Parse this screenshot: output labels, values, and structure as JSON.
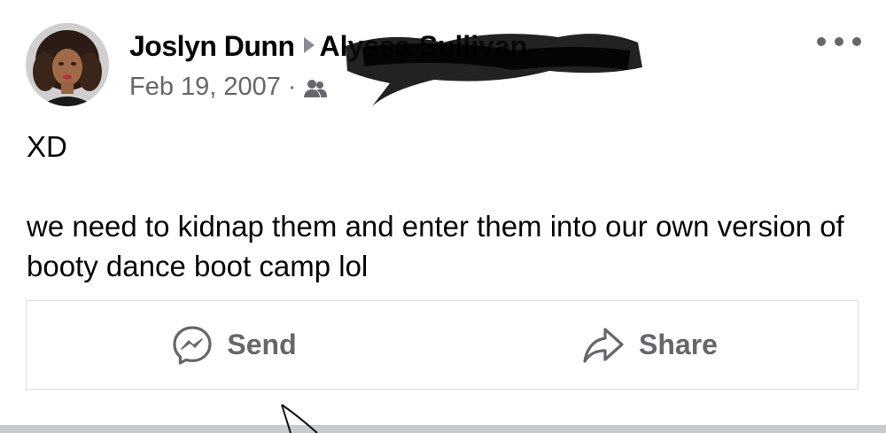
{
  "post": {
    "author": "Joslyn Dunn",
    "recipient": "Alyssa Sullivan",
    "date": "Feb 19, 2007",
    "separator": "·",
    "audience_icon": "friends-icon",
    "body_lines": [
      "XD",
      "we need to kidnap them and enter them into our own version of booty dance boot camp lol"
    ]
  },
  "actions": {
    "send_label": "Send",
    "send_icon": "messenger-icon",
    "share_label": "Share",
    "share_icon": "share-arrow-icon"
  },
  "colors": {
    "text_primary": "#050505",
    "text_secondary": "#65676b",
    "border": "#dadde1"
  }
}
